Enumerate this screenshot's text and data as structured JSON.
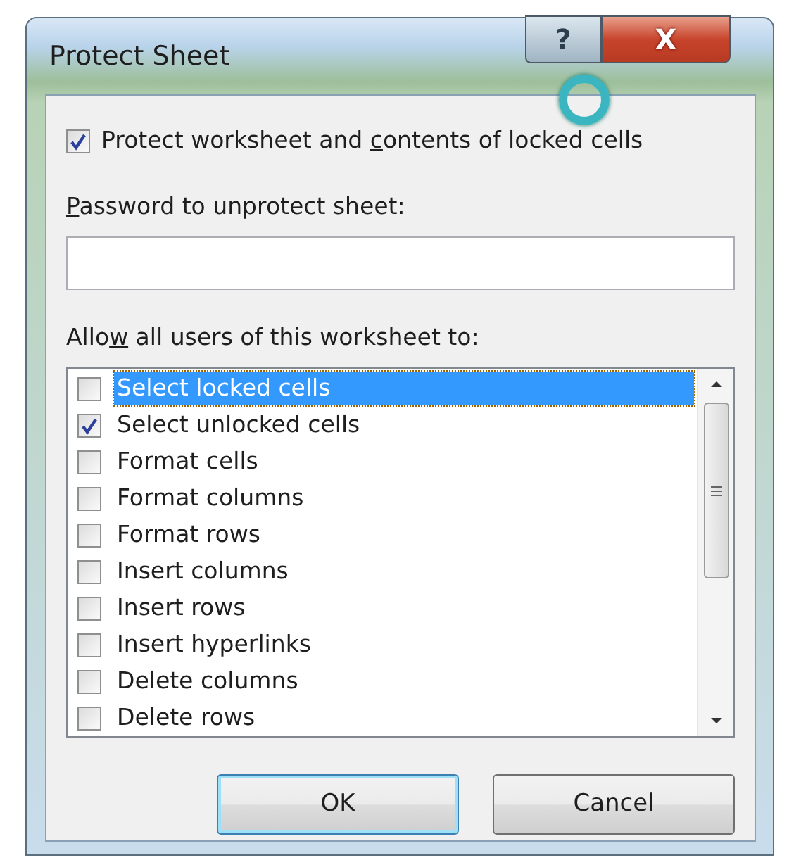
{
  "window": {
    "title": "Protect Sheet",
    "buttons": [
      {
        "kind": "help",
        "label": "?"
      },
      {
        "kind": "close",
        "label": "X"
      }
    ]
  },
  "protect": {
    "checked": true,
    "label": {
      "before": "Protect worksheet and ",
      "key": "c",
      "after": "ontents of locked cells"
    }
  },
  "password": {
    "label": {
      "key": "P",
      "after": "assword to unprotect sheet:"
    }
  },
  "allow": {
    "label": {
      "before": "Allo",
      "key": "w",
      "after": " all users of this worksheet to:"
    }
  },
  "permissions": [
    {
      "label": "Select locked cells",
      "checked": false,
      "selected": true
    },
    {
      "label": "Select unlocked cells",
      "checked": true,
      "selected": false
    },
    {
      "label": "Format cells",
      "checked": false,
      "selected": false
    },
    {
      "label": "Format columns",
      "checked": false,
      "selected": false
    },
    {
      "label": "Format rows",
      "checked": false,
      "selected": false
    },
    {
      "label": "Insert columns",
      "checked": false,
      "selected": false
    },
    {
      "label": "Insert rows",
      "checked": false,
      "selected": false
    },
    {
      "label": "Insert hyperlinks",
      "checked": false,
      "selected": false
    },
    {
      "label": "Delete columns",
      "checked": false,
      "selected": false
    },
    {
      "label": "Delete rows",
      "checked": false,
      "selected": false
    }
  ],
  "buttons": [
    {
      "label": "OK",
      "default": true
    },
    {
      "label": "Cancel",
      "default": false
    }
  ]
}
